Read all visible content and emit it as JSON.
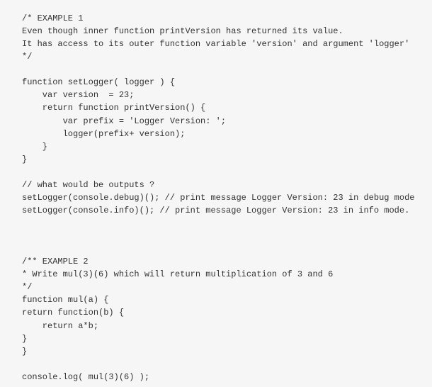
{
  "code_block": {
    "lines": [
      "/* EXAMPLE 1",
      "Even though inner function printVersion has returned its value.",
      "It has access to its outer function variable 'version' and argument 'logger'",
      "*/",
      "",
      "function setLogger( logger ) {",
      "    var version  = 23;",
      "    return function printVersion() {",
      "        var prefix = 'Logger Version: ';",
      "        logger(prefix+ version);",
      "    }",
      "}",
      "",
      "// what would be outputs ?",
      "setLogger(console.debug)(); // print message Logger Version: 23 in debug mode",
      "setLogger(console.info)(); // print message Logger Version: 23 in info mode.",
      "",
      "",
      "",
      "/** EXAMPLE 2",
      "* Write mul(3)(6) which will return multiplication of 3 and 6",
      "*/",
      "function mul(a) {",
      "return function(b) {",
      "    return a*b;",
      "}",
      "}",
      "",
      "console.log( mul(3)(6) );"
    ]
  },
  "colors": {
    "background": "#f6f6f6",
    "text": "#333333"
  }
}
